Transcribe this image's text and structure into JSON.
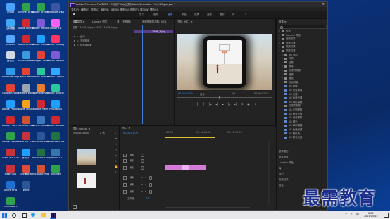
{
  "desktop": {
    "col1": [
      {
        "label": "此电脑",
        "color": "#4aa3ff"
      },
      {
        "label": "控制面板",
        "color": "#3fa9f5"
      },
      {
        "label": "Network",
        "color": "#55a7ff"
      },
      {
        "label": "回收站",
        "color": "#cfd8e3"
      },
      {
        "label": "Microsoft Edge",
        "color": "#2e9be8"
      },
      {
        "label": "Google Chrome",
        "color": "#e34234"
      },
      {
        "label": "Adobe Photoshop",
        "color": "#1fa0ff"
      },
      {
        "label": "Adobe Flash Professional",
        "color": "#d3282f"
      },
      {
        "label": "Adobe Dreamweaver",
        "color": "#2fa34b"
      },
      {
        "label": "AutoCAD 2014",
        "color": "#c8323a"
      },
      {
        "label": "Flash CS6",
        "color": "#c8323a"
      },
      {
        "label": "Axure RP 8",
        "color": "#1f6fd1"
      },
      {
        "label": "Camtasia 9",
        "color": "#2fa34b"
      }
    ],
    "col2": [
      {
        "label": "NxPanel Dreamweaver",
        "color": "#2fa34b"
      },
      {
        "label": "Adobe Animate",
        "color": "#d3282f"
      },
      {
        "label": "Adobe Acrobat",
        "color": "#d3282f"
      },
      {
        "label": "Navicat Premium",
        "color": "#3a9be0"
      },
      {
        "label": "WPS Office",
        "color": "#e34234"
      },
      {
        "label": "VMware Workstation",
        "color": "#9aa5b1"
      },
      {
        "label": "Adobe Illustrator",
        "color": "#f7a21b"
      },
      {
        "label": "Microsoft PowerPoint",
        "color": "#d35230"
      },
      {
        "label": "AutoCAD 2019",
        "color": "#c8323a"
      },
      {
        "label": "腾讯QQ",
        "color": "#1fa0ff"
      },
      {
        "label": "SW编辑器",
        "color": "#e04b3a"
      },
      {
        "label": "Word",
        "color": "#2b579a"
      }
    ],
    "col3": [
      {
        "label": "Adobe Dreamweaver",
        "color": "#2fa34b"
      },
      {
        "label": "Adobe Premiere",
        "color": "#7b5cd6"
      },
      {
        "label": "Adobe Photoshop",
        "color": "#1fa0ff"
      },
      {
        "label": "Google Chrome",
        "color": "#e34234"
      },
      {
        "label": "Adobe Audition",
        "color": "#2cc79e"
      },
      {
        "label": "WampServer",
        "color": "#e87f2c"
      },
      {
        "label": "Adobe Flash",
        "color": "#d3282f"
      },
      {
        "label": "IBM SPSS Statistics 20",
        "color": "#3a78c2"
      },
      {
        "label": "Microsoft Word",
        "color": "#2b579a"
      },
      {
        "label": "Microsoft Excel 2010",
        "color": "#217346"
      },
      {
        "label": "Microsoft PowerPoint",
        "color": "#d35230"
      }
    ],
    "col4": [
      {
        "label": "Microsoft Visio",
        "color": "#3955a3"
      },
      {
        "label": "Adobe XD",
        "color": "#ff61f6"
      },
      {
        "label": "Adobe InDesign",
        "color": "#ff3366"
      },
      {
        "label": "Adobe Premiere",
        "color": "#7b5cd6"
      },
      {
        "label": "Adobe Lightroom",
        "color": "#31a8ff"
      },
      {
        "label": "Adobe Audition",
        "color": "#2cc79e"
      },
      {
        "label": "Photoshop",
        "color": "#1fa0ff"
      },
      {
        "label": "Adobe Acrobat",
        "color": "#d3282f"
      },
      {
        "label": "Microsoft Excel",
        "color": "#217346"
      },
      {
        "label": "python 3.5",
        "color": "#3776ab"
      },
      {
        "label": "HBuilder",
        "color": "#2fa34b"
      }
    ]
  },
  "app": {
    "title": "Adobe Premiere Pro 2020 - C:\\用户\\Vap\\文档\\Adobe\\Premiere Pro\\14.0\\youyoo *",
    "menu": [
      "文件(F)",
      "编辑(E)",
      "剪辑(C)",
      "序列(S)",
      "标记(M)",
      "图形(G)",
      "视图(V)",
      "窗口(W)",
      "帮助(H)"
    ],
    "workspaces": [
      "学习",
      "组件",
      "编辑",
      "颜色",
      "效果",
      "音频",
      "图形",
      "库",
      "»"
    ],
    "source": {
      "tabs": [
        "效果控件 ≡",
        "Lumetri 范围",
        "源：(无剪辑)",
        "音频剪辑混合器：MC1"
      ],
      "clip_line": "主要 * 1098_1.jpg ▾  MC1 * 1098_1.jpg",
      "items": [
        "运动",
        "不透明度",
        "时间重映射"
      ],
      "clip_bar": "1098_1.jpg"
    },
    "program": {
      "tab": "节目：MC1 ≡",
      "timecode_left": "00:00:01:09",
      "fit": "适合",
      "fraction": "1/2",
      "timecode_right": "00:00:02:24"
    },
    "effects": {
      "tab": "效果 ≡",
      "tree": [
        {
          "label": "预设",
          "indent": 0,
          "kind": "folder"
        },
        {
          "label": "Lumetri 预设",
          "indent": 0,
          "kind": "folder"
        },
        {
          "label": "音频效果",
          "indent": 0,
          "kind": "folder"
        },
        {
          "label": "音频过渡",
          "indent": 0,
          "kind": "folder"
        },
        {
          "label": "视频效果",
          "indent": 0,
          "kind": "folder"
        },
        {
          "label": "视频过渡",
          "indent": 0,
          "kind": "folder"
        },
        {
          "label": "3D 运动",
          "indent": 1,
          "kind": "folder"
        },
        {
          "label": "内滑",
          "indent": 1,
          "kind": "folder"
        },
        {
          "label": "划像",
          "indent": 1,
          "kind": "folder"
        },
        {
          "label": "擦除",
          "indent": 1,
          "kind": "folder"
        },
        {
          "label": "沉浸式视频",
          "indent": 1,
          "kind": "folder"
        },
        {
          "label": "溶解",
          "indent": 1,
          "kind": "folder"
        },
        {
          "label": "缩放",
          "indent": 1,
          "kind": "folder"
        },
        {
          "label": "页面剥落",
          "indent": 1,
          "kind": "folder"
        },
        {
          "label": "VR 划像",
          "indent": 2,
          "kind": "fx"
        },
        {
          "label": "VR 渐变擦除",
          "indent": 2,
          "kind": "fx"
        },
        {
          "label": "VR 光线",
          "indent": 2,
          "kind": "fx"
        },
        {
          "label": "VR 色度泄漏",
          "indent": 2,
          "kind": "fx"
        },
        {
          "label": "VR 球形模糊",
          "indent": 2,
          "kind": "fx"
        },
        {
          "label": "沉浸式视频",
          "indent": 1,
          "kind": "folder"
        },
        {
          "label": "VR 光圈擦除",
          "indent": 2,
          "kind": "fx"
        },
        {
          "label": "VR 默认划像",
          "indent": 2,
          "kind": "fx"
        },
        {
          "label": "VR 渐变擦除",
          "indent": 2,
          "kind": "fx"
        },
        {
          "label": "VR 漏光",
          "indent": 2,
          "kind": "fx"
        },
        {
          "label": "VR 球形模糊",
          "indent": 2,
          "kind": "fx"
        },
        {
          "label": "VR 色度泄漏",
          "indent": 2,
          "kind": "fx"
        },
        {
          "label": "VR 随机块",
          "indent": 2,
          "kind": "fx"
        },
        {
          "label": "VR 默认过渡",
          "indent": 2,
          "kind": "fx"
        }
      ],
      "side_items": [
        "基本图形",
        "基本声音",
        "Lumetri 颜色",
        "库",
        "标记",
        "历史记录",
        "信息"
      ]
    },
    "project": {
      "tab": "项目: youyoo ≡",
      "file": "youyoo.prproj",
      "count": "6 项"
    },
    "timeline": {
      "tab": "MC1 ≡",
      "timecode": "00:00:01:09",
      "ruler": [
        ":00:00",
        "00:00:05:00",
        "00:00:10:00"
      ],
      "video_tracks": [
        "V3",
        "V2",
        "V1"
      ],
      "audio_tracks": [
        "A1",
        "A2",
        "A3"
      ],
      "master": "主声道",
      "master_value": "0.0"
    }
  },
  "watermark": "最需教育",
  "taskbar": {
    "time": "8:22",
    "date": "2021/10/15",
    "lang": "中"
  }
}
